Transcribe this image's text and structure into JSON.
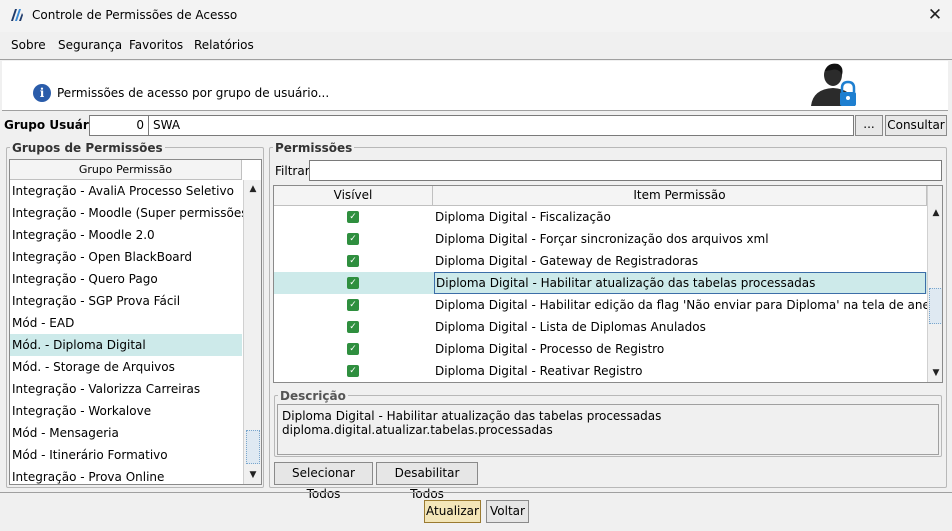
{
  "window": {
    "title": "Controle de Permissões de Acesso",
    "close_glyph": "✕",
    "app_icon": "app-logo-icon"
  },
  "menu": [
    {
      "label": "Sobre"
    },
    {
      "label": "Segurança"
    },
    {
      "label": "Favoritos"
    },
    {
      "label": "Relatórios"
    }
  ],
  "header": {
    "text": "Permissões de acesso por grupo de usuário...",
    "info_glyph": "i"
  },
  "grupo_usuario": {
    "label": "Grupo Usuário:",
    "id": "0",
    "name": "SWA",
    "lookup_label": "...",
    "consultar_label": "Consultar"
  },
  "grupos_permissoes": {
    "title": "Grupos de Permissões",
    "column": "Grupo Permissão",
    "items": [
      "Integração - AvaliA Processo Seletivo",
      "Integração - Moodle (Super permissões)",
      "Integração - Moodle 2.0",
      "Integração - Open BlackBoard",
      "Integração - Quero Pago",
      "Integração - SGP Prova Fácil",
      "Mód - EAD",
      "Mód. - Diploma Digital",
      "Mód. - Storage de Arquivos",
      "Integração - Valorizza Carreiras",
      "Integração - Workalove",
      "Mód - Mensageria",
      "Mód - Itinerário Formativo",
      "Integração - Prova Online"
    ],
    "selected_index": 7
  },
  "permissoes": {
    "title": "Permissões",
    "filter_label": "Filtrar:",
    "filter_value": "",
    "columns": {
      "visivel": "Visível",
      "item": "Item Permissão"
    },
    "rows": [
      {
        "item": "Diploma Digital - Fiscalização",
        "visible": true
      },
      {
        "item": "Diploma Digital - Forçar sincronização dos arquivos xml",
        "visible": true
      },
      {
        "item": "Diploma Digital - Gateway de Registradoras",
        "visible": true
      },
      {
        "item": "Diploma Digital - Habilitar atualização das tabelas processadas",
        "visible": true
      },
      {
        "item": "Diploma Digital - Habilitar edição da flag 'Não enviar para Diploma' na tela de anexos",
        "visible": true
      },
      {
        "item": "Diploma Digital - Lista de Diplomas Anulados",
        "visible": true
      },
      {
        "item": "Diploma Digital - Processo de Registro",
        "visible": true
      },
      {
        "item": "Diploma Digital - Reativar Registro",
        "visible": true
      }
    ],
    "selected_index": 3,
    "check_glyph": "✓"
  },
  "descricao": {
    "title": "Descrição",
    "text": "Diploma Digital - Habilitar atualização das tabelas processadas diploma.digital.atualizar.tabelas.processadas"
  },
  "buttons": {
    "selecionar_todos": "Selecionar Todos",
    "desabilitar_todos": "Desabilitar Todos",
    "atualizar": "Atualizar",
    "voltar": "Voltar"
  },
  "scroll_glyphs": {
    "up": "▲",
    "down": "▼"
  },
  "colors": {
    "selection": "#cdeaea",
    "check": "#2f8f3f",
    "primary_button": "#f3e6b8",
    "info": "#2a5caa",
    "lock": "#1e7fd0"
  }
}
